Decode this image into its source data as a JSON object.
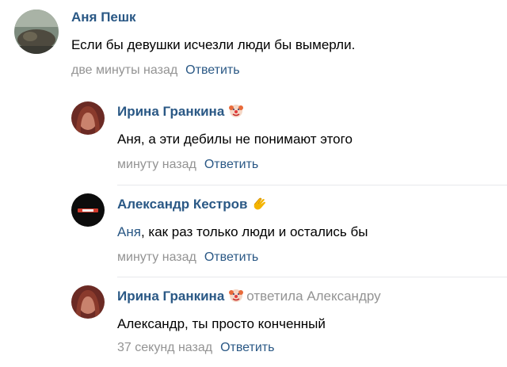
{
  "comments": [
    {
      "author": "Аня Пешк",
      "text": "Если бы девушки исчезли люди бы вымерли.",
      "time": "две минуты назад",
      "reply_label": "Ответить"
    },
    {
      "author": "Ирина Гранкина",
      "author_emoji": "clown-face-icon",
      "text": "Аня, а эти дебилы не понимают этого",
      "time": "минуту назад",
      "reply_label": "Ответить"
    },
    {
      "author": "Александр Кестров",
      "author_emoji": "clapping-hands-icon",
      "text_mention": "Аня",
      "text_rest": ", как раз только люди и остались бы",
      "time": "минуту назад",
      "reply_label": "Ответить"
    },
    {
      "author": "Ирина Гранкина",
      "author_emoji": "clown-face-icon",
      "reply_to": "ответила Александру",
      "text": "Александр, ты просто конченный",
      "time": "37 секунд назад",
      "reply_label": "Ответить"
    }
  ],
  "colors": {
    "link": "#2a5885",
    "meta": "#939393",
    "divider": "#e7e8ec"
  }
}
